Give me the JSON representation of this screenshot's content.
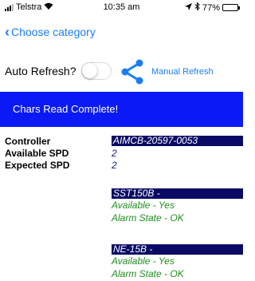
{
  "status_bar": {
    "carrier": "Telstra",
    "time": "10:35 am",
    "battery": "77%",
    "battery_level": 0.77,
    "icons": [
      "signal-icon",
      "wifi-icon",
      "location-icon",
      "bluetooth-icon",
      "battery-icon"
    ]
  },
  "nav": {
    "back_label": "Choose category"
  },
  "controls": {
    "auto_refresh_label": "Auto Refresh?",
    "auto_refresh_on": false,
    "manual_refresh_label": "Manual Refresh"
  },
  "banner": {
    "text": "Chars Read Complete!",
    "color": "#0a19f5"
  },
  "info": {
    "controller_label": "Controller",
    "controller_value": "AIMCB-20597-0053",
    "available_spd_label": "Available SPD",
    "available_spd_value": "2",
    "expected_spd_label": "Expected SPD",
    "expected_spd_value": "2"
  },
  "devices": [
    {
      "name": "SST150B -",
      "available": "Available - Yes",
      "alarm": "Alarm State - OK"
    },
    {
      "name": "NE-15B  -",
      "available": "Available - Yes",
      "alarm": "Alarm State - OK"
    }
  ],
  "colors": {
    "accent": "#1a7ef7",
    "header_bar": "#0a0a66",
    "value_text": "#1a1a8c",
    "ok_text": "#1f8f1f"
  }
}
